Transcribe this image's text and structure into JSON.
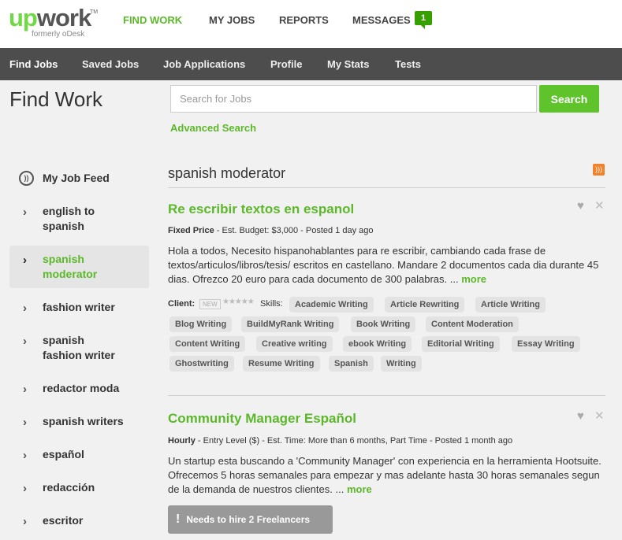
{
  "brand": {
    "logo_up": "up",
    "logo_work": "work",
    "logo_tm": "TM",
    "formerly": "formerly oDesk"
  },
  "topnav": {
    "items": [
      {
        "label": "FIND WORK"
      },
      {
        "label": "MY JOBS"
      },
      {
        "label": "REPORTS"
      },
      {
        "label": "MESSAGES"
      }
    ],
    "messages_count": "1"
  },
  "subnav": {
    "items": [
      {
        "label": "Find Jobs"
      },
      {
        "label": "Saved Jobs"
      },
      {
        "label": "Job Applications"
      },
      {
        "label": "Profile"
      },
      {
        "label": "My Stats"
      },
      {
        "label": "Tests"
      }
    ]
  },
  "page": {
    "title": "Find Work"
  },
  "search": {
    "placeholder": "Search for Jobs",
    "button_label": "Search",
    "advanced_label": "Advanced Search"
  },
  "sidebar": {
    "feed_label": "My Job Feed",
    "items": [
      {
        "label": "english to spanish"
      },
      {
        "label": "spanish moderator"
      },
      {
        "label": "fashion writer"
      },
      {
        "label": "spanish fashion writer"
      },
      {
        "label": "redactor moda"
      },
      {
        "label": "spanish writers"
      },
      {
        "label": "español"
      },
      {
        "label": "redacción"
      },
      {
        "label": "escritor"
      }
    ]
  },
  "results": {
    "title": "spanish moderator",
    "jobs": [
      {
        "title": "Re escribir textos en espanol",
        "type": "Fixed Price",
        "meta": " - Est. Budget: $3,000 - Posted 1 day ago",
        "description": "Hola a todos, Necesito hispanohablantes para re escribir, cambiando cada frase de textos/articulos/libros/tesis/ escritos en castellano. Mandare 2 documentos cada dia durante 45 dias. Ofrezco 20 euro para cada documento de 300 palabras. ...",
        "more": "more",
        "client_label": "Client:",
        "new_badge": "NEW",
        "stars": "★★★★★",
        "skills_label": "Skills:",
        "skills": [
          "Academic Writing",
          "Article Rewriting",
          "Article Writing",
          "Blog Writing",
          "BuildMyRank Writing",
          "Book Writing",
          "Content Moderation",
          "Content Writing",
          "Creative writing",
          "ebook Writing",
          "Editorial Writing",
          "Essay Writing",
          "Ghostwriting",
          "Resume Writing",
          "Spanish",
          "Writing"
        ]
      },
      {
        "title": "Community Manager Español",
        "type": "Hourly",
        "meta": " - Entry Level ($) - Est. Time: More than 6 months, Part Time - Posted 1 month ago",
        "description": "Un startup esta buscando a 'Community Manager' con experiencia en la herramienta Hootsuite. Ofrecemos 5 horas semanales para empezar y mas adelante hasta 30 horas semanales segun de la demanda de nuestros clientes. ...",
        "more": "more",
        "hire_notice": "Needs to hire 2 Freelancers"
      }
    ]
  },
  "icons": {
    "feed": "broadcast-icon",
    "chevron": "chevron-right-icon",
    "rss": "rss-icon",
    "heart": "heart-icon",
    "close": "close-icon",
    "alert": "exclamation-icon"
  },
  "colors": {
    "brand_green": "#5cb82a",
    "subnav_bg": "#4d4d4d",
    "rss_orange": "#f0822a",
    "chip_bg": "#e3e3e3"
  }
}
